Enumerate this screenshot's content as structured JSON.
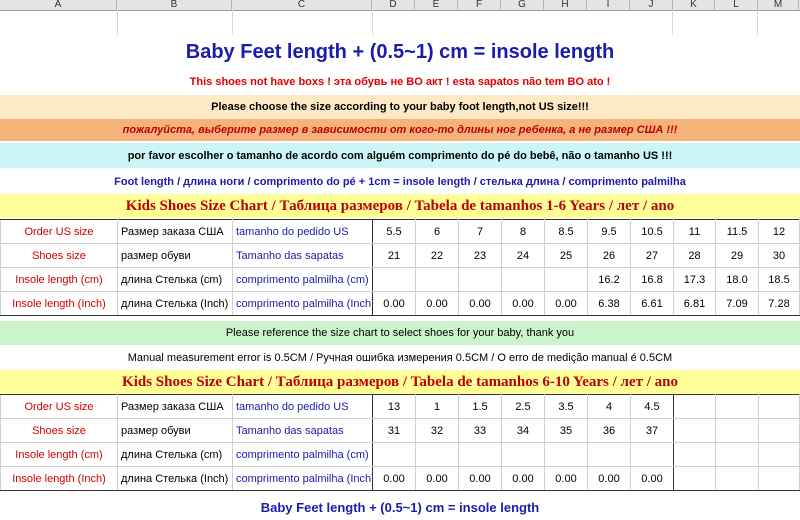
{
  "columns": [
    "A",
    "B",
    "C",
    "D",
    "E",
    "F",
    "G",
    "H",
    "I",
    "J",
    "K",
    "L",
    "M"
  ],
  "title": "Baby Feet length + (0.5~1) cm = insole length",
  "no_box": "This shoes not have boxs !  эта обувь не BO акт !  esta sapatos não tem BO ato !",
  "choose_en": "Please choose the size according to your baby foot length,not US size!!!",
  "choose_ru": "пожалуйста, выберите размер в зависимости от кого-то длины ног ребенка, а не размер США !!!",
  "choose_pt": "por favor escolher o tamanho de acordo com alguém comprimento do pé do bebê, não o tamanho US !!!",
  "foot_formula": "Foot length / длина ноги / comprimento do pé + 1cm = insole length / стелька длина / comprimento palmilha",
  "chart1_title": "Kids Shoes Size Chart / Таблица размеров /  Tabela de tamanhos       1-6 Years / лет / ano",
  "chart2_title": "Kids Shoes Size Chart / Таблица размеров /  Tabela de tamanhos        6-10  Years / лет /  ano",
  "reference_note": "Please reference the size chart to select shoes for your baby, thank you",
  "error_note": "Manual measurement error is 0.5CM / Ручная ошибка измерения 0.5CM / O erro de medição manual é 0.5CM",
  "footer": "Baby Feet length + (0.5~1) cm = insole length",
  "table1": [
    {
      "en": "Order US size",
      "ru": "Размер заказа США",
      "pt": "tamanho do pedido US",
      "vals": [
        "5.5",
        "6",
        "7",
        "8",
        "8.5",
        "9.5",
        "10.5",
        "11",
        "11.5",
        "12"
      ]
    },
    {
      "en": "Shoes size",
      "ru": "размер обуви",
      "pt": "Tamanho das sapatas",
      "vals": [
        "21",
        "22",
        "23",
        "24",
        "25",
        "26",
        "27",
        "28",
        "29",
        "30"
      ]
    },
    {
      "en": "Insole length (cm)",
      "ru": "длина Стелька (cm)",
      "pt": "comprimento palmilha (cm)",
      "vals": [
        "",
        "",
        "",
        "",
        "",
        "16.2",
        "16.8",
        "17.3",
        "18.0",
        "18.5"
      ]
    },
    {
      "en": "Insole length (Inch)",
      "ru": "длина Стелька (Inch)",
      "pt": "comprimento palmilha (Inch)",
      "vals": [
        "0.00",
        "0.00",
        "0.00",
        "0.00",
        "0.00",
        "6.38",
        "6.61",
        "6.81",
        "7.09",
        "7.28"
      ]
    }
  ],
  "table2": [
    {
      "en": "Order US size",
      "ru": "Размер заказа США",
      "pt": "tamanho do pedido US",
      "vals": [
        "13",
        "1",
        "1.5",
        "2.5",
        "3.5",
        "4",
        "4.5",
        "",
        "",
        ""
      ]
    },
    {
      "en": "Shoes size",
      "ru": "размер обуви",
      "pt": "Tamanho das sapatas",
      "vals": [
        "31",
        "32",
        "33",
        "34",
        "35",
        "36",
        "37",
        "",
        "",
        ""
      ]
    },
    {
      "en": "Insole length (cm)",
      "ru": "длина Стелька (cm)",
      "pt": "comprimento palmilha (cm)",
      "vals": [
        "",
        "",
        "",
        "",
        "",
        "",
        "",
        "",
        "",
        ""
      ]
    },
    {
      "en": "Insole length (Inch)",
      "ru": "длина Стелька (Inch)",
      "pt": "comprimento palmilha (Inch)",
      "vals": [
        "0.00",
        "0.00",
        "0.00",
        "0.00",
        "0.00",
        "0.00",
        "0.00",
        "",
        "",
        ""
      ]
    }
  ]
}
